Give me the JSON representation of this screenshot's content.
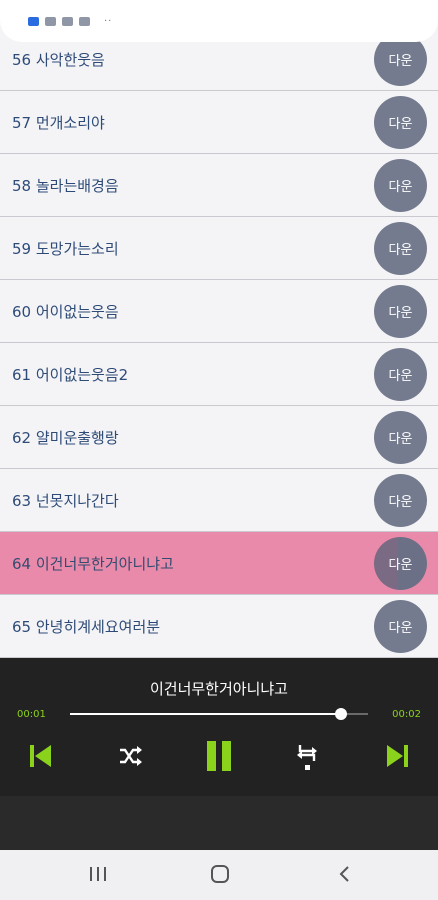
{
  "status_bar": {
    "icons": [
      "app-icon",
      "image-icon",
      "image-icon",
      "image-icon"
    ],
    "more": "··"
  },
  "tracks": [
    {
      "title": "56 사악한웃음",
      "download": "다운"
    },
    {
      "title": "57 먼개소리야",
      "download": "다운"
    },
    {
      "title": "58 놀라는배경음",
      "download": "다운"
    },
    {
      "title": "59 도망가는소리",
      "download": "다운"
    },
    {
      "title": "60 어이없는웃음",
      "download": "다운"
    },
    {
      "title": "61 어이없는웃음2",
      "download": "다운"
    },
    {
      "title": "62 얄미운출행랑",
      "download": "다운"
    },
    {
      "title": "63 넌못지나간다",
      "download": "다운"
    },
    {
      "title": "64 이건너무한거아니냐고",
      "download": "다운",
      "active": true
    },
    {
      "title": "65 안녕히계세요여러분",
      "download": "다운"
    }
  ],
  "player": {
    "now_playing": "이건너무한거아니냐고",
    "time_current": "00:01",
    "time_total": "00:02",
    "progress": 0.91,
    "accent_color": "#8bd21c"
  },
  "nav": {
    "recent_icon": "recent-apps-icon",
    "home_icon": "home-icon",
    "back_icon": "back-icon"
  }
}
